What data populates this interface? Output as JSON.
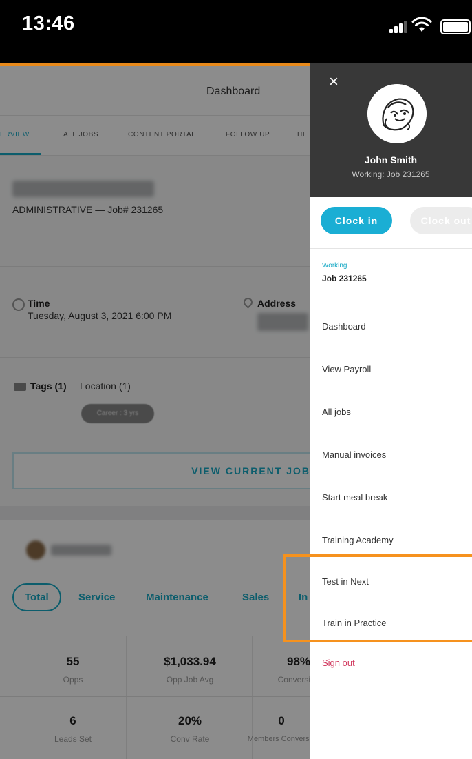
{
  "status_bar": {
    "time": "13:46"
  },
  "app": {
    "title": "Dashboard",
    "tabs": [
      "ERVIEW",
      "ALL JOBS",
      "CONTENT PORTAL",
      "FOLLOW UP",
      "HI"
    ],
    "active_tab": 0,
    "job_line": "ADMINISTRATIVE — Job# 231265",
    "time_label": "Time",
    "time_value": "Tuesday, August 3, 2021 6:00 PM",
    "address_label": "Address",
    "tags_label": "Tags (1)",
    "location_label": "Location (1)",
    "career_pill": "Career : 3 yrs",
    "view_current_job": "VIEW CURRENT JOB",
    "filters": [
      "Total",
      "Service",
      "Maintenance",
      "Sales",
      "In"
    ],
    "stats": [
      {
        "value": "55",
        "label": "Opps"
      },
      {
        "value": "$1,033.94",
        "label": "Opp Job Avg"
      },
      {
        "value": "98%",
        "label": "Conversion"
      },
      {
        "value": "6",
        "label": "Leads Set"
      },
      {
        "value": "20%",
        "label": "Conv Rate"
      },
      {
        "value": "0",
        "label": "Members Conversio"
      }
    ]
  },
  "drawer": {
    "name": "John Smith",
    "working_status": "Working: Job 231265",
    "clock_in": "Clock in",
    "clock_out": "Clock out",
    "working_label": "Working",
    "working_job": "Job 231265",
    "menu": [
      "Dashboard",
      "View Payroll",
      "All jobs",
      "Manual invoices",
      "Start meal break",
      "Training Academy",
      "Test in Next",
      "Train in Practice"
    ],
    "sign_out": "Sign out"
  },
  "colors": {
    "accent": "#1aaed4",
    "highlight": "#f6921e",
    "sign_out": "#d0355b",
    "drawer_header": "#383838"
  }
}
